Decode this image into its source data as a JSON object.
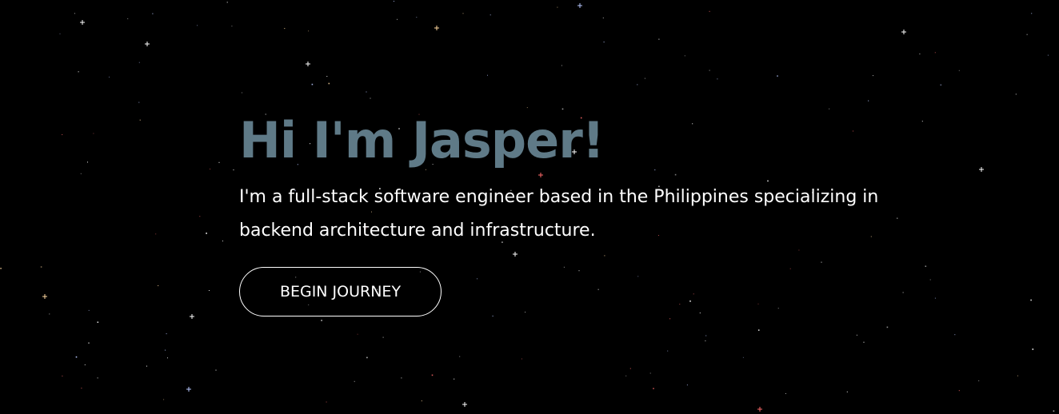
{
  "theme": {
    "background": "#000000",
    "title_color": "#5f7a87",
    "text_color": "#ffffff",
    "star_colors": [
      "#ffffff",
      "#ffffff",
      "#ffffff",
      "#ffd9a0",
      "#b8c8ff",
      "#ff6a6a"
    ]
  },
  "hero": {
    "title": "Hi I'm Jasper!",
    "description": "I'm a full-stack software engineer based in the Philippines specializing in backend architecture and infrastructure.",
    "cta_label": "BEGIN JOURNEY"
  }
}
